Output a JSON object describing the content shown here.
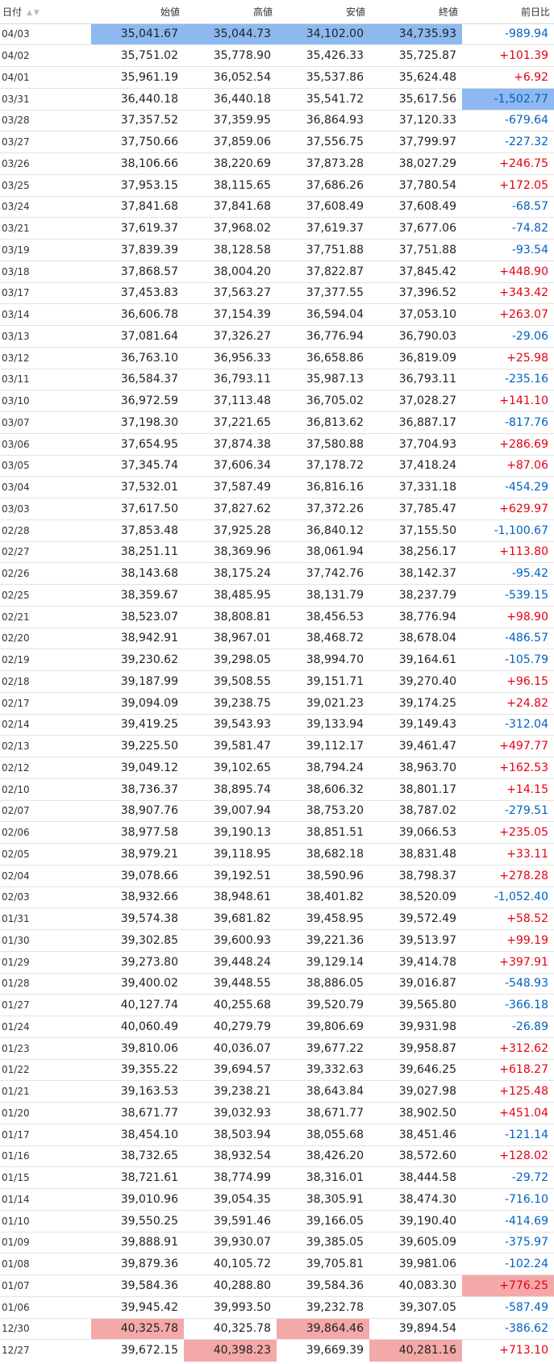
{
  "headers": {
    "date": "日付",
    "open": "始値",
    "high": "高値",
    "low": "安値",
    "close": "終値",
    "change": "前日比",
    "sort_icons": "▲▼"
  },
  "colors": {
    "up": "#e60012",
    "down": "#0061c3",
    "highlight_blue": "#8db9f0",
    "highlight_red": "#f4a9a9"
  },
  "rows": [
    {
      "date": "04/03",
      "open": "35,041.67",
      "high": "35,044.73",
      "low": "34,102.00",
      "close": "34,735.93",
      "change": "-989.94",
      "hl": [
        "blue",
        "blue",
        "blue",
        "blue",
        null
      ]
    },
    {
      "date": "04/02",
      "open": "35,751.02",
      "high": "35,778.90",
      "low": "35,426.33",
      "close": "35,725.87",
      "change": "+101.39"
    },
    {
      "date": "04/01",
      "open": "35,961.19",
      "high": "36,052.54",
      "low": "35,537.86",
      "close": "35,624.48",
      "change": "+6.92"
    },
    {
      "date": "03/31",
      "open": "36,440.18",
      "high": "36,440.18",
      "low": "35,541.72",
      "close": "35,617.56",
      "change": "-1,502.77",
      "hl": [
        null,
        null,
        null,
        null,
        "blue"
      ]
    },
    {
      "date": "03/28",
      "open": "37,357.52",
      "high": "37,359.95",
      "low": "36,864.93",
      "close": "37,120.33",
      "change": "-679.64"
    },
    {
      "date": "03/27",
      "open": "37,750.66",
      "high": "37,859.06",
      "low": "37,556.75",
      "close": "37,799.97",
      "change": "-227.32"
    },
    {
      "date": "03/26",
      "open": "38,106.66",
      "high": "38,220.69",
      "low": "37,873.28",
      "close": "38,027.29",
      "change": "+246.75"
    },
    {
      "date": "03/25",
      "open": "37,953.15",
      "high": "38,115.65",
      "low": "37,686.26",
      "close": "37,780.54",
      "change": "+172.05"
    },
    {
      "date": "03/24",
      "open": "37,841.68",
      "high": "37,841.68",
      "low": "37,608.49",
      "close": "37,608.49",
      "change": "-68.57"
    },
    {
      "date": "03/21",
      "open": "37,619.37",
      "high": "37,968.02",
      "low": "37,619.37",
      "close": "37,677.06",
      "change": "-74.82"
    },
    {
      "date": "03/19",
      "open": "37,839.39",
      "high": "38,128.58",
      "low": "37,751.88",
      "close": "37,751.88",
      "change": "-93.54"
    },
    {
      "date": "03/18",
      "open": "37,868.57",
      "high": "38,004.20",
      "low": "37,822.87",
      "close": "37,845.42",
      "change": "+448.90"
    },
    {
      "date": "03/17",
      "open": "37,453.83",
      "high": "37,563.27",
      "low": "37,377.55",
      "close": "37,396.52",
      "change": "+343.42"
    },
    {
      "date": "03/14",
      "open": "36,606.78",
      "high": "37,154.39",
      "low": "36,594.04",
      "close": "37,053.10",
      "change": "+263.07"
    },
    {
      "date": "03/13",
      "open": "37,081.64",
      "high": "37,326.27",
      "low": "36,776.94",
      "close": "36,790.03",
      "change": "-29.06"
    },
    {
      "date": "03/12",
      "open": "36,763.10",
      "high": "36,956.33",
      "low": "36,658.86",
      "close": "36,819.09",
      "change": "+25.98"
    },
    {
      "date": "03/11",
      "open": "36,584.37",
      "high": "36,793.11",
      "low": "35,987.13",
      "close": "36,793.11",
      "change": "-235.16"
    },
    {
      "date": "03/10",
      "open": "36,972.59",
      "high": "37,113.48",
      "low": "36,705.02",
      "close": "37,028.27",
      "change": "+141.10"
    },
    {
      "date": "03/07",
      "open": "37,198.30",
      "high": "37,221.65",
      "low": "36,813.62",
      "close": "36,887.17",
      "change": "-817.76"
    },
    {
      "date": "03/06",
      "open": "37,654.95",
      "high": "37,874.38",
      "low": "37,580.88",
      "close": "37,704.93",
      "change": "+286.69"
    },
    {
      "date": "03/05",
      "open": "37,345.74",
      "high": "37,606.34",
      "low": "37,178.72",
      "close": "37,418.24",
      "change": "+87.06"
    },
    {
      "date": "03/04",
      "open": "37,532.01",
      "high": "37,587.49",
      "low": "36,816.16",
      "close": "37,331.18",
      "change": "-454.29"
    },
    {
      "date": "03/03",
      "open": "37,617.50",
      "high": "37,827.62",
      "low": "37,372.26",
      "close": "37,785.47",
      "change": "+629.97"
    },
    {
      "date": "02/28",
      "open": "37,853.48",
      "high": "37,925.28",
      "low": "36,840.12",
      "close": "37,155.50",
      "change": "-1,100.67"
    },
    {
      "date": "02/27",
      "open": "38,251.11",
      "high": "38,369.96",
      "low": "38,061.94",
      "close": "38,256.17",
      "change": "+113.80"
    },
    {
      "date": "02/26",
      "open": "38,143.68",
      "high": "38,175.24",
      "low": "37,742.76",
      "close": "38,142.37",
      "change": "-95.42"
    },
    {
      "date": "02/25",
      "open": "38,359.67",
      "high": "38,485.95",
      "low": "38,131.79",
      "close": "38,237.79",
      "change": "-539.15"
    },
    {
      "date": "02/21",
      "open": "38,523.07",
      "high": "38,808.81",
      "low": "38,456.53",
      "close": "38,776.94",
      "change": "+98.90"
    },
    {
      "date": "02/20",
      "open": "38,942.91",
      "high": "38,967.01",
      "low": "38,468.72",
      "close": "38,678.04",
      "change": "-486.57"
    },
    {
      "date": "02/19",
      "open": "39,230.62",
      "high": "39,298.05",
      "low": "38,994.70",
      "close": "39,164.61",
      "change": "-105.79"
    },
    {
      "date": "02/18",
      "open": "39,187.99",
      "high": "39,508.55",
      "low": "39,151.71",
      "close": "39,270.40",
      "change": "+96.15"
    },
    {
      "date": "02/17",
      "open": "39,094.09",
      "high": "39,238.75",
      "low": "39,021.23",
      "close": "39,174.25",
      "change": "+24.82"
    },
    {
      "date": "02/14",
      "open": "39,419.25",
      "high": "39,543.93",
      "low": "39,133.94",
      "close": "39,149.43",
      "change": "-312.04"
    },
    {
      "date": "02/13",
      "open": "39,225.50",
      "high": "39,581.47",
      "low": "39,112.17",
      "close": "39,461.47",
      "change": "+497.77"
    },
    {
      "date": "02/12",
      "open": "39,049.12",
      "high": "39,102.65",
      "low": "38,794.24",
      "close": "38,963.70",
      "change": "+162.53"
    },
    {
      "date": "02/10",
      "open": "38,736.37",
      "high": "38,895.74",
      "low": "38,606.32",
      "close": "38,801.17",
      "change": "+14.15"
    },
    {
      "date": "02/07",
      "open": "38,907.76",
      "high": "39,007.94",
      "low": "38,753.20",
      "close": "38,787.02",
      "change": "-279.51"
    },
    {
      "date": "02/06",
      "open": "38,977.58",
      "high": "39,190.13",
      "low": "38,851.51",
      "close": "39,066.53",
      "change": "+235.05"
    },
    {
      "date": "02/05",
      "open": "38,979.21",
      "high": "39,118.95",
      "low": "38,682.18",
      "close": "38,831.48",
      "change": "+33.11"
    },
    {
      "date": "02/04",
      "open": "39,078.66",
      "high": "39,192.51",
      "low": "38,590.96",
      "close": "38,798.37",
      "change": "+278.28"
    },
    {
      "date": "02/03",
      "open": "38,932.66",
      "high": "38,948.61",
      "low": "38,401.82",
      "close": "38,520.09",
      "change": "-1,052.40"
    },
    {
      "date": "01/31",
      "open": "39,574.38",
      "high": "39,681.82",
      "low": "39,458.95",
      "close": "39,572.49",
      "change": "+58.52"
    },
    {
      "date": "01/30",
      "open": "39,302.85",
      "high": "39,600.93",
      "low": "39,221.36",
      "close": "39,513.97",
      "change": "+99.19"
    },
    {
      "date": "01/29",
      "open": "39,273.80",
      "high": "39,448.24",
      "low": "39,129.14",
      "close": "39,414.78",
      "change": "+397.91"
    },
    {
      "date": "01/28",
      "open": "39,400.02",
      "high": "39,448.55",
      "low": "38,886.05",
      "close": "39,016.87",
      "change": "-548.93"
    },
    {
      "date": "01/27",
      "open": "40,127.74",
      "high": "40,255.68",
      "low": "39,520.79",
      "close": "39,565.80",
      "change": "-366.18"
    },
    {
      "date": "01/24",
      "open": "40,060.49",
      "high": "40,279.79",
      "low": "39,806.69",
      "close": "39,931.98",
      "change": "-26.89"
    },
    {
      "date": "01/23",
      "open": "39,810.06",
      "high": "40,036.07",
      "low": "39,677.22",
      "close": "39,958.87",
      "change": "+312.62"
    },
    {
      "date": "01/22",
      "open": "39,355.22",
      "high": "39,694.57",
      "low": "39,332.63",
      "close": "39,646.25",
      "change": "+618.27"
    },
    {
      "date": "01/21",
      "open": "39,163.53",
      "high": "39,238.21",
      "low": "38,643.84",
      "close": "39,027.98",
      "change": "+125.48"
    },
    {
      "date": "01/20",
      "open": "38,671.77",
      "high": "39,032.93",
      "low": "38,671.77",
      "close": "38,902.50",
      "change": "+451.04"
    },
    {
      "date": "01/17",
      "open": "38,454.10",
      "high": "38,503.94",
      "low": "38,055.68",
      "close": "38,451.46",
      "change": "-121.14"
    },
    {
      "date": "01/16",
      "open": "38,732.65",
      "high": "38,932.54",
      "low": "38,426.20",
      "close": "38,572.60",
      "change": "+128.02"
    },
    {
      "date": "01/15",
      "open": "38,721.61",
      "high": "38,774.99",
      "low": "38,316.01",
      "close": "38,444.58",
      "change": "-29.72"
    },
    {
      "date": "01/14",
      "open": "39,010.96",
      "high": "39,054.35",
      "low": "38,305.91",
      "close": "38,474.30",
      "change": "-716.10"
    },
    {
      "date": "01/10",
      "open": "39,550.25",
      "high": "39,591.46",
      "low": "39,166.05",
      "close": "39,190.40",
      "change": "-414.69"
    },
    {
      "date": "01/09",
      "open": "39,888.91",
      "high": "39,930.07",
      "low": "39,385.05",
      "close": "39,605.09",
      "change": "-375.97"
    },
    {
      "date": "01/08",
      "open": "39,879.36",
      "high": "40,105.72",
      "low": "39,705.81",
      "close": "39,981.06",
      "change": "-102.24"
    },
    {
      "date": "01/07",
      "open": "39,584.36",
      "high": "40,288.80",
      "low": "39,584.36",
      "close": "40,083.30",
      "change": "+776.25",
      "hl": [
        null,
        null,
        null,
        null,
        "red"
      ]
    },
    {
      "date": "01/06",
      "open": "39,945.42",
      "high": "39,993.50",
      "low": "39,232.78",
      "close": "39,307.05",
      "change": "-587.49"
    },
    {
      "date": "12/30",
      "open": "40,325.78",
      "high": "40,325.78",
      "low": "39,864.46",
      "close": "39,894.54",
      "change": "-386.62",
      "hl": [
        "red",
        null,
        "red",
        null,
        null
      ]
    },
    {
      "date": "12/27",
      "open": "39,672.15",
      "high": "40,398.23",
      "low": "39,669.39",
      "close": "40,281.16",
      "change": "+713.10",
      "hl": [
        null,
        "red",
        null,
        "red",
        null
      ]
    }
  ]
}
